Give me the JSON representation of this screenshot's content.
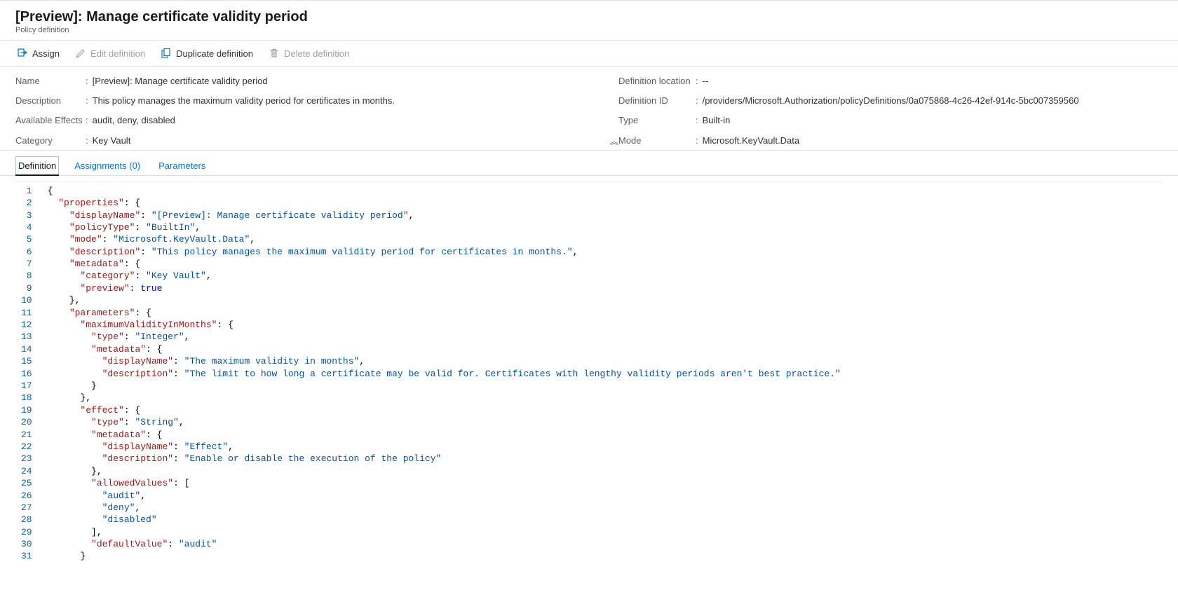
{
  "header": {
    "title": "[Preview]: Manage certificate validity period",
    "subtitle": "Policy definition"
  },
  "toolbar": {
    "assign": "Assign",
    "edit": "Edit definition",
    "duplicate": "Duplicate definition",
    "delete": "Delete definition"
  },
  "details": {
    "left": [
      {
        "label": "Name",
        "value": "[Preview]: Manage certificate validity period"
      },
      {
        "label": "Description",
        "value": "This policy manages the maximum validity period for certificates in months."
      },
      {
        "label": "Available Effects",
        "value": "audit, deny, disabled"
      },
      {
        "label": "Category",
        "value": "Key Vault"
      }
    ],
    "right": [
      {
        "label": "Definition location",
        "value": "--"
      },
      {
        "label": "Definition ID",
        "value": "/providers/Microsoft.Authorization/policyDefinitions/0a075868-4c26-42ef-914c-5bc007359560"
      },
      {
        "label": "Type",
        "value": "Built-in"
      },
      {
        "label": "Mode",
        "value": "Microsoft.KeyVault.Data"
      }
    ]
  },
  "tabs": {
    "definition": "Definition",
    "assignments": "Assignments (0)",
    "parameters": "Parameters"
  },
  "code_lines": [
    [
      [
        "punc",
        "{"
      ]
    ],
    [
      [
        "punc",
        "  "
      ],
      [
        "key",
        "\"properties\""
      ],
      [
        "punc",
        ": {"
      ]
    ],
    [
      [
        "punc",
        "    "
      ],
      [
        "key",
        "\"displayName\""
      ],
      [
        "punc",
        ": "
      ],
      [
        "str",
        "\"[Preview]: Manage certificate validity period\""
      ],
      [
        "punc",
        ","
      ]
    ],
    [
      [
        "punc",
        "    "
      ],
      [
        "key",
        "\"policyType\""
      ],
      [
        "punc",
        ": "
      ],
      [
        "str",
        "\"BuiltIn\""
      ],
      [
        "punc",
        ","
      ]
    ],
    [
      [
        "punc",
        "    "
      ],
      [
        "key",
        "\"mode\""
      ],
      [
        "punc",
        ": "
      ],
      [
        "str",
        "\"Microsoft.KeyVault.Data\""
      ],
      [
        "punc",
        ","
      ]
    ],
    [
      [
        "punc",
        "    "
      ],
      [
        "key",
        "\"description\""
      ],
      [
        "punc",
        ": "
      ],
      [
        "str",
        "\"This policy manages the maximum validity period for certificates in months.\""
      ],
      [
        "punc",
        ","
      ]
    ],
    [
      [
        "punc",
        "    "
      ],
      [
        "key",
        "\"metadata\""
      ],
      [
        "punc",
        ": {"
      ]
    ],
    [
      [
        "punc",
        "      "
      ],
      [
        "key",
        "\"category\""
      ],
      [
        "punc",
        ": "
      ],
      [
        "str",
        "\"Key Vault\""
      ],
      [
        "punc",
        ","
      ]
    ],
    [
      [
        "punc",
        "      "
      ],
      [
        "key",
        "\"preview\""
      ],
      [
        "punc",
        ": "
      ],
      [
        "bool",
        "true"
      ]
    ],
    [
      [
        "punc",
        "    },"
      ]
    ],
    [
      [
        "punc",
        "    "
      ],
      [
        "key",
        "\"parameters\""
      ],
      [
        "punc",
        ": {"
      ]
    ],
    [
      [
        "punc",
        "      "
      ],
      [
        "key",
        "\"maximumValidityInMonths\""
      ],
      [
        "punc",
        ": {"
      ]
    ],
    [
      [
        "punc",
        "        "
      ],
      [
        "key",
        "\"type\""
      ],
      [
        "punc",
        ": "
      ],
      [
        "str",
        "\"Integer\""
      ],
      [
        "punc",
        ","
      ]
    ],
    [
      [
        "punc",
        "        "
      ],
      [
        "key",
        "\"metadata\""
      ],
      [
        "punc",
        ": {"
      ]
    ],
    [
      [
        "punc",
        "          "
      ],
      [
        "key",
        "\"displayName\""
      ],
      [
        "punc",
        ": "
      ],
      [
        "str",
        "\"The maximum validity in months\""
      ],
      [
        "punc",
        ","
      ]
    ],
    [
      [
        "punc",
        "          "
      ],
      [
        "key",
        "\"description\""
      ],
      [
        "punc",
        ": "
      ],
      [
        "str",
        "\"The limit to how long a certificate may be valid for. Certificates with lengthy validity periods aren't best practice.\""
      ]
    ],
    [
      [
        "punc",
        "        }"
      ]
    ],
    [
      [
        "punc",
        "      },"
      ]
    ],
    [
      [
        "punc",
        "      "
      ],
      [
        "key",
        "\"effect\""
      ],
      [
        "punc",
        ": {"
      ]
    ],
    [
      [
        "punc",
        "        "
      ],
      [
        "key",
        "\"type\""
      ],
      [
        "punc",
        ": "
      ],
      [
        "str",
        "\"String\""
      ],
      [
        "punc",
        ","
      ]
    ],
    [
      [
        "punc",
        "        "
      ],
      [
        "key",
        "\"metadata\""
      ],
      [
        "punc",
        ": {"
      ]
    ],
    [
      [
        "punc",
        "          "
      ],
      [
        "key",
        "\"displayName\""
      ],
      [
        "punc",
        ": "
      ],
      [
        "str",
        "\"Effect\""
      ],
      [
        "punc",
        ","
      ]
    ],
    [
      [
        "punc",
        "          "
      ],
      [
        "key",
        "\"description\""
      ],
      [
        "punc",
        ": "
      ],
      [
        "str",
        "\"Enable or disable the execution of the policy\""
      ]
    ],
    [
      [
        "punc",
        "        },"
      ]
    ],
    [
      [
        "punc",
        "        "
      ],
      [
        "key",
        "\"allowedValues\""
      ],
      [
        "punc",
        ": ["
      ]
    ],
    [
      [
        "punc",
        "          "
      ],
      [
        "str",
        "\"audit\""
      ],
      [
        "punc",
        ","
      ]
    ],
    [
      [
        "punc",
        "          "
      ],
      [
        "str",
        "\"deny\""
      ],
      [
        "punc",
        ","
      ]
    ],
    [
      [
        "punc",
        "          "
      ],
      [
        "str",
        "\"disabled\""
      ]
    ],
    [
      [
        "punc",
        "        ],"
      ]
    ],
    [
      [
        "punc",
        "        "
      ],
      [
        "key",
        "\"defaultValue\""
      ],
      [
        "punc",
        ": "
      ],
      [
        "str",
        "\"audit\""
      ]
    ],
    [
      [
        "punc",
        "      }"
      ]
    ]
  ]
}
